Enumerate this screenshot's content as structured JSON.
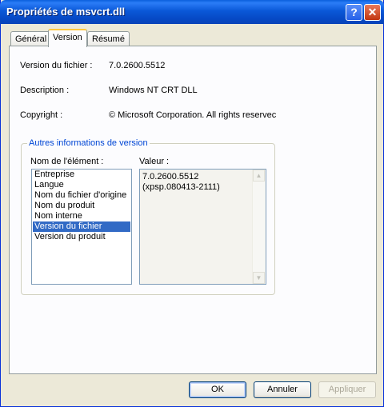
{
  "window": {
    "title": "Propriétés de msvcrt.dll"
  },
  "titlebar": {
    "help_glyph": "?",
    "close_glyph": "✕"
  },
  "tabs": [
    {
      "label": "Général"
    },
    {
      "label": "Version"
    },
    {
      "label": "Résumé"
    }
  ],
  "active_tab": "Version",
  "properties": {
    "file_version_label": "Version du fichier :",
    "file_version_value": "7.0.2600.5512",
    "description_label": "Description :",
    "description_value": "Windows NT CRT DLL",
    "copyright_label": "Copyright :",
    "copyright_value": "© Microsoft Corporation. All rights reservec"
  },
  "other_info": {
    "group_title": "Autres informations de version",
    "name_header": "Nom de l'élément :",
    "value_header": "Valeur :",
    "items": [
      "Entreprise",
      "Langue",
      "Nom du fichier d'origine",
      "Nom du produit",
      "Nom interne",
      "Version du fichier",
      "Version du produit"
    ],
    "selected_item": "Version du fichier",
    "value_lines": [
      "7.0.2600.5512",
      "(xpsp.080413-2111)"
    ]
  },
  "buttons": {
    "ok": "OK",
    "cancel": "Annuler",
    "apply": "Appliquer"
  },
  "colors": {
    "titlebar": "#0a58d8",
    "selection": "#316ac5",
    "group_title": "#0046d5"
  }
}
